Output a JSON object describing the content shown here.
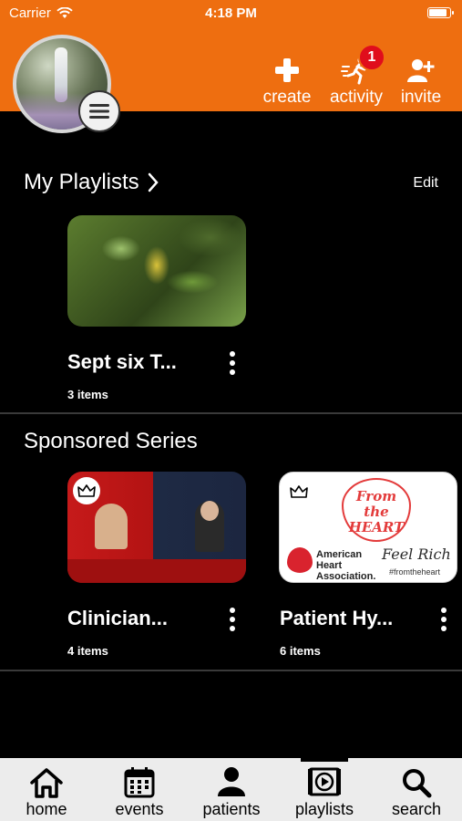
{
  "status_bar": {
    "carrier": "Carrier",
    "time": "4:18 PM"
  },
  "header": {
    "actions": {
      "create": "create",
      "activity": "activity",
      "activity_badge": "1",
      "invite": "invite"
    }
  },
  "my_playlists": {
    "title": "My Playlists",
    "edit_label": "Edit",
    "items": [
      {
        "title": "Sept six T...",
        "count": "3 items"
      }
    ]
  },
  "sponsored_series": {
    "title": "Sponsored Series",
    "items": [
      {
        "title": "Clinician...",
        "count": "4 items"
      },
      {
        "title": "Patient Hy...",
        "count": "6 items"
      }
    ],
    "thumb_texts": {
      "from_the_heart": "From the HEART",
      "aha": "American Heart Association.",
      "feel_rich": "Feel Rich",
      "hashtag": "#fromtheheart"
    }
  },
  "tabbar": {
    "tabs": [
      {
        "label": "home",
        "icon": "home-icon"
      },
      {
        "label": "events",
        "icon": "calendar-icon"
      },
      {
        "label": "patients",
        "icon": "person-icon"
      },
      {
        "label": "playlists",
        "icon": "playlist-icon"
      },
      {
        "label": "search",
        "icon": "search-icon"
      }
    ],
    "active": "playlists"
  },
  "colors": {
    "brand_orange": "#ee6e10",
    "badge_red": "#e00d1c",
    "background": "#000000",
    "tabbar_bg": "#ececec"
  }
}
